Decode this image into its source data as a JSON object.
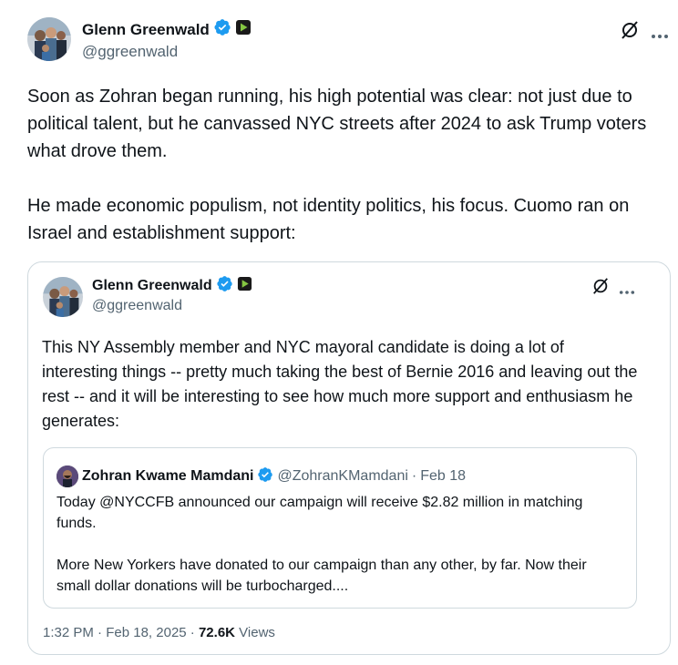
{
  "main_tweet": {
    "author_name": "Glenn Greenwald",
    "handle": "@ggreenwald",
    "paragraphs": [
      "Soon as Zohran began running, his high potential was clear: not just due to political talent, but he canvassed NYC streets after 2024 to ask Trump voters what drove them.",
      "He made economic populism, not identity politics, his focus. Cuomo ran on Israel and establishment support:"
    ]
  },
  "quoted_tweet": {
    "author_name": "Glenn Greenwald",
    "handle": "@ggreenwald",
    "text": "This NY Assembly member and NYC mayoral candidate is doing a lot of interesting things -- pretty much taking the best of Bernie 2016 and leaving out the rest -- and it will be interesting to see how much more support and enthusiasm he generates:",
    "nested": {
      "author_name": "Zohran Kwame Mamdani",
      "handle": "@ZohranKMamdani",
      "separator": "·",
      "date": "Feb 18",
      "paragraphs": [
        "Today @NYCCFB announced our campaign will receive $2.82 million in matching funds.",
        "More New Yorkers have donated to our campaign than any other, by far. Now their small dollar donations will be turbocharged...."
      ]
    },
    "meta": {
      "time": "1:32 PM",
      "date": "Feb 18, 2025",
      "views_count": "72.6K",
      "views_label": "Views",
      "sep": "·"
    }
  },
  "icons": {
    "verified": "verified-badge-icon",
    "rumble": "rumble-badge-icon",
    "grok": "grok-icon",
    "more": "more-icon"
  },
  "colors": {
    "verified": "#1d9bf0",
    "rumble": "#85c742",
    "secondary_text": "#536471",
    "border": "#cfd9de"
  }
}
